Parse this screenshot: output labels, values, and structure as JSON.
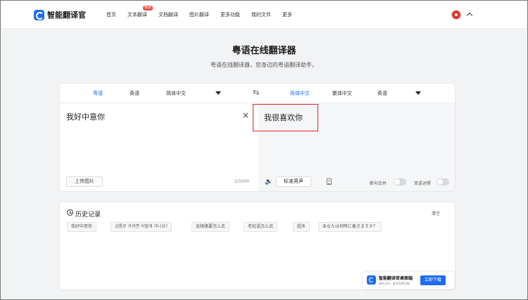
{
  "app": {
    "logo_text": "智能翻译官"
  },
  "nav": {
    "items": [
      "首页",
      "文本翻译",
      "文档翻译",
      "图片翻译",
      "更多功能",
      "我的文件",
      "更多"
    ],
    "badge": "免费"
  },
  "header": {
    "title": "粤语在线翻译器",
    "subtitle": "粤语在线翻译器，您身边的粤语翻译助手。"
  },
  "source_langs": [
    "粤语",
    "英语",
    "简体中文"
  ],
  "target_langs": [
    "简体中文",
    "繁体中文",
    "英语"
  ],
  "source": {
    "text": "我好中意你",
    "upload_label": "上传图片",
    "char_count": "5/5000"
  },
  "result": {
    "text": "我很喜欢你",
    "voice_label": "标准男声"
  },
  "toggles": {
    "merge_label": "断句合并",
    "bilingual_label": "双语对照"
  },
  "history": {
    "title": "历史记录",
    "clear_label": "清空",
    "items": [
      "我好中意你",
      "금룡로 가려면 어떻게 가나요?",
      "金陵路要怎么走",
      "老挝语怎么说",
      "超多",
      "あなたは何時に着きますか？"
    ]
  },
  "promo": {
    "title": "智能翻译官桌面端",
    "subtitle": "海外文件、更多免费功能",
    "button": "立即下载"
  },
  "colors": {
    "accent": "#1e6bf0",
    "highlight": "#d9262b",
    "badge": "#f04b3c"
  }
}
